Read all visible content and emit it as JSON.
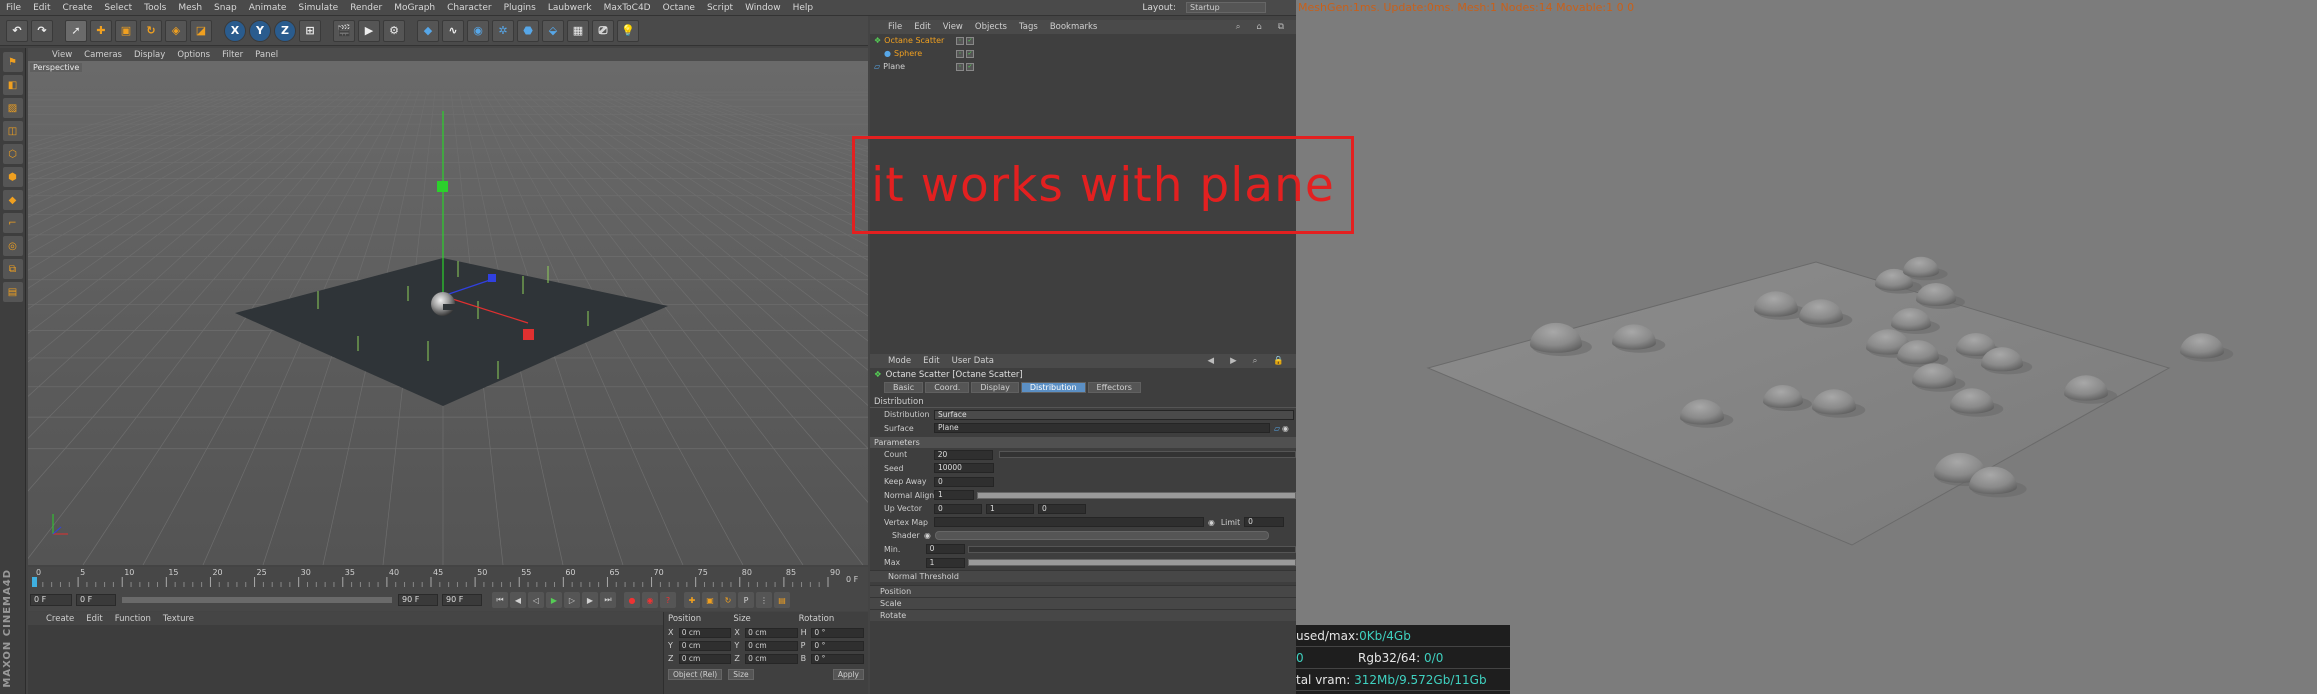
{
  "menubar": {
    "items": [
      "File",
      "Edit",
      "Create",
      "Select",
      "Tools",
      "Mesh",
      "Snap",
      "Animate",
      "Simulate",
      "Render",
      "MoGraph",
      "Character",
      "Plugins",
      "Laubwerk",
      "MaxToC4D",
      "Octane",
      "Script",
      "Window",
      "Help"
    ],
    "layout_label": "Layout:",
    "layout_value": "Startup"
  },
  "toolbar": {
    "axis_x": "X",
    "axis_y": "Y",
    "axis_z": "Z"
  },
  "viewport": {
    "menu": [
      "View",
      "Cameras",
      "Display",
      "Options",
      "Filter",
      "Panel"
    ],
    "label": "Perspective"
  },
  "timeline": {
    "ticks": [
      "0",
      "5",
      "10",
      "15",
      "20",
      "25",
      "30",
      "35",
      "40",
      "45",
      "50",
      "55",
      "60",
      "65",
      "70",
      "75",
      "80",
      "85",
      "90"
    ],
    "end_frame": "0 F"
  },
  "transport": {
    "start": "0 F",
    "current": "0 F",
    "end": "90 F",
    "end2": "90 F"
  },
  "material_manager": {
    "menu": [
      "Create",
      "Edit",
      "Function",
      "Texture"
    ]
  },
  "brand": {
    "logo": "MAXON CINEMA4D"
  },
  "coordinates": {
    "headers": [
      "Position",
      "Size",
      "Rotation"
    ],
    "rows": [
      {
        "axis": "X",
        "pos": "0 cm",
        "size": "0 cm",
        "rot_axis": "H",
        "rot": "0 °"
      },
      {
        "axis": "Y",
        "pos": "0 cm",
        "size": "0 cm",
        "rot_axis": "P",
        "rot": "0 °"
      },
      {
        "axis": "Z",
        "pos": "0 cm",
        "size": "0 cm",
        "rot_axis": "B",
        "rot": "0 °"
      }
    ],
    "mode": "Object (Rel)",
    "size_mode": "Size",
    "apply": "Apply"
  },
  "object_manager": {
    "menu": [
      "File",
      "Edit",
      "View",
      "Objects",
      "Tags",
      "Bookmarks"
    ],
    "objects": [
      {
        "name": "Octane Scatter",
        "color": "#f0a020"
      },
      {
        "name": "Sphere",
        "color": "#f0a020"
      },
      {
        "name": "Plane",
        "color": "#d0d0d0"
      }
    ]
  },
  "attribute_manager": {
    "menu": [
      "Mode",
      "Edit",
      "User Data"
    ],
    "title": "Octane Scatter [Octane Scatter]",
    "tabs": [
      "Basic",
      "Coord.",
      "Display",
      "Distribution",
      "Effectors"
    ],
    "active_tab": "Distribution",
    "section": "Distribution",
    "distribution_label": "Distribution",
    "distribution_value": "Surface",
    "surface_label": "Surface",
    "surface_value": "Plane",
    "parameters_label": "Parameters",
    "params": {
      "count_label": "Count",
      "count": "20",
      "seed_label": "Seed",
      "seed": "10000",
      "keep_away_label": "Keep Away",
      "keep_away": "0",
      "normal_align_label": "Normal Align",
      "normal_align": "1",
      "up_vector_label": "Up Vector",
      "up_vector": [
        "0",
        "1",
        "0"
      ],
      "vertex_map_label": "Vertex Map",
      "limit_label": "Limit",
      "limit": "0",
      "shader_label": "Shader",
      "min_label": "Min.",
      "min": "0",
      "max_label": "Max",
      "max": "1"
    },
    "normal_threshold": "Normal Threshold",
    "collapsed": [
      "Position",
      "Scale",
      "Rotate"
    ]
  },
  "annotation": {
    "text": "it works with plane",
    "color": "#e32020"
  },
  "render": {
    "status_line": "MeshGen:1ms. Update:0ms. Mesh:1 Nodes:14 Movable:1  0 0",
    "stats": [
      {
        "label": "used/max:",
        "value": "0Kb/4Gb"
      },
      {
        "label": "0",
        "value": ""
      },
      {
        "label": "Rgb32/64: ",
        "value": "0/0"
      },
      {
        "label": "tal vram: ",
        "value": "312Mb/9.572Gb/11Gb"
      }
    ]
  }
}
